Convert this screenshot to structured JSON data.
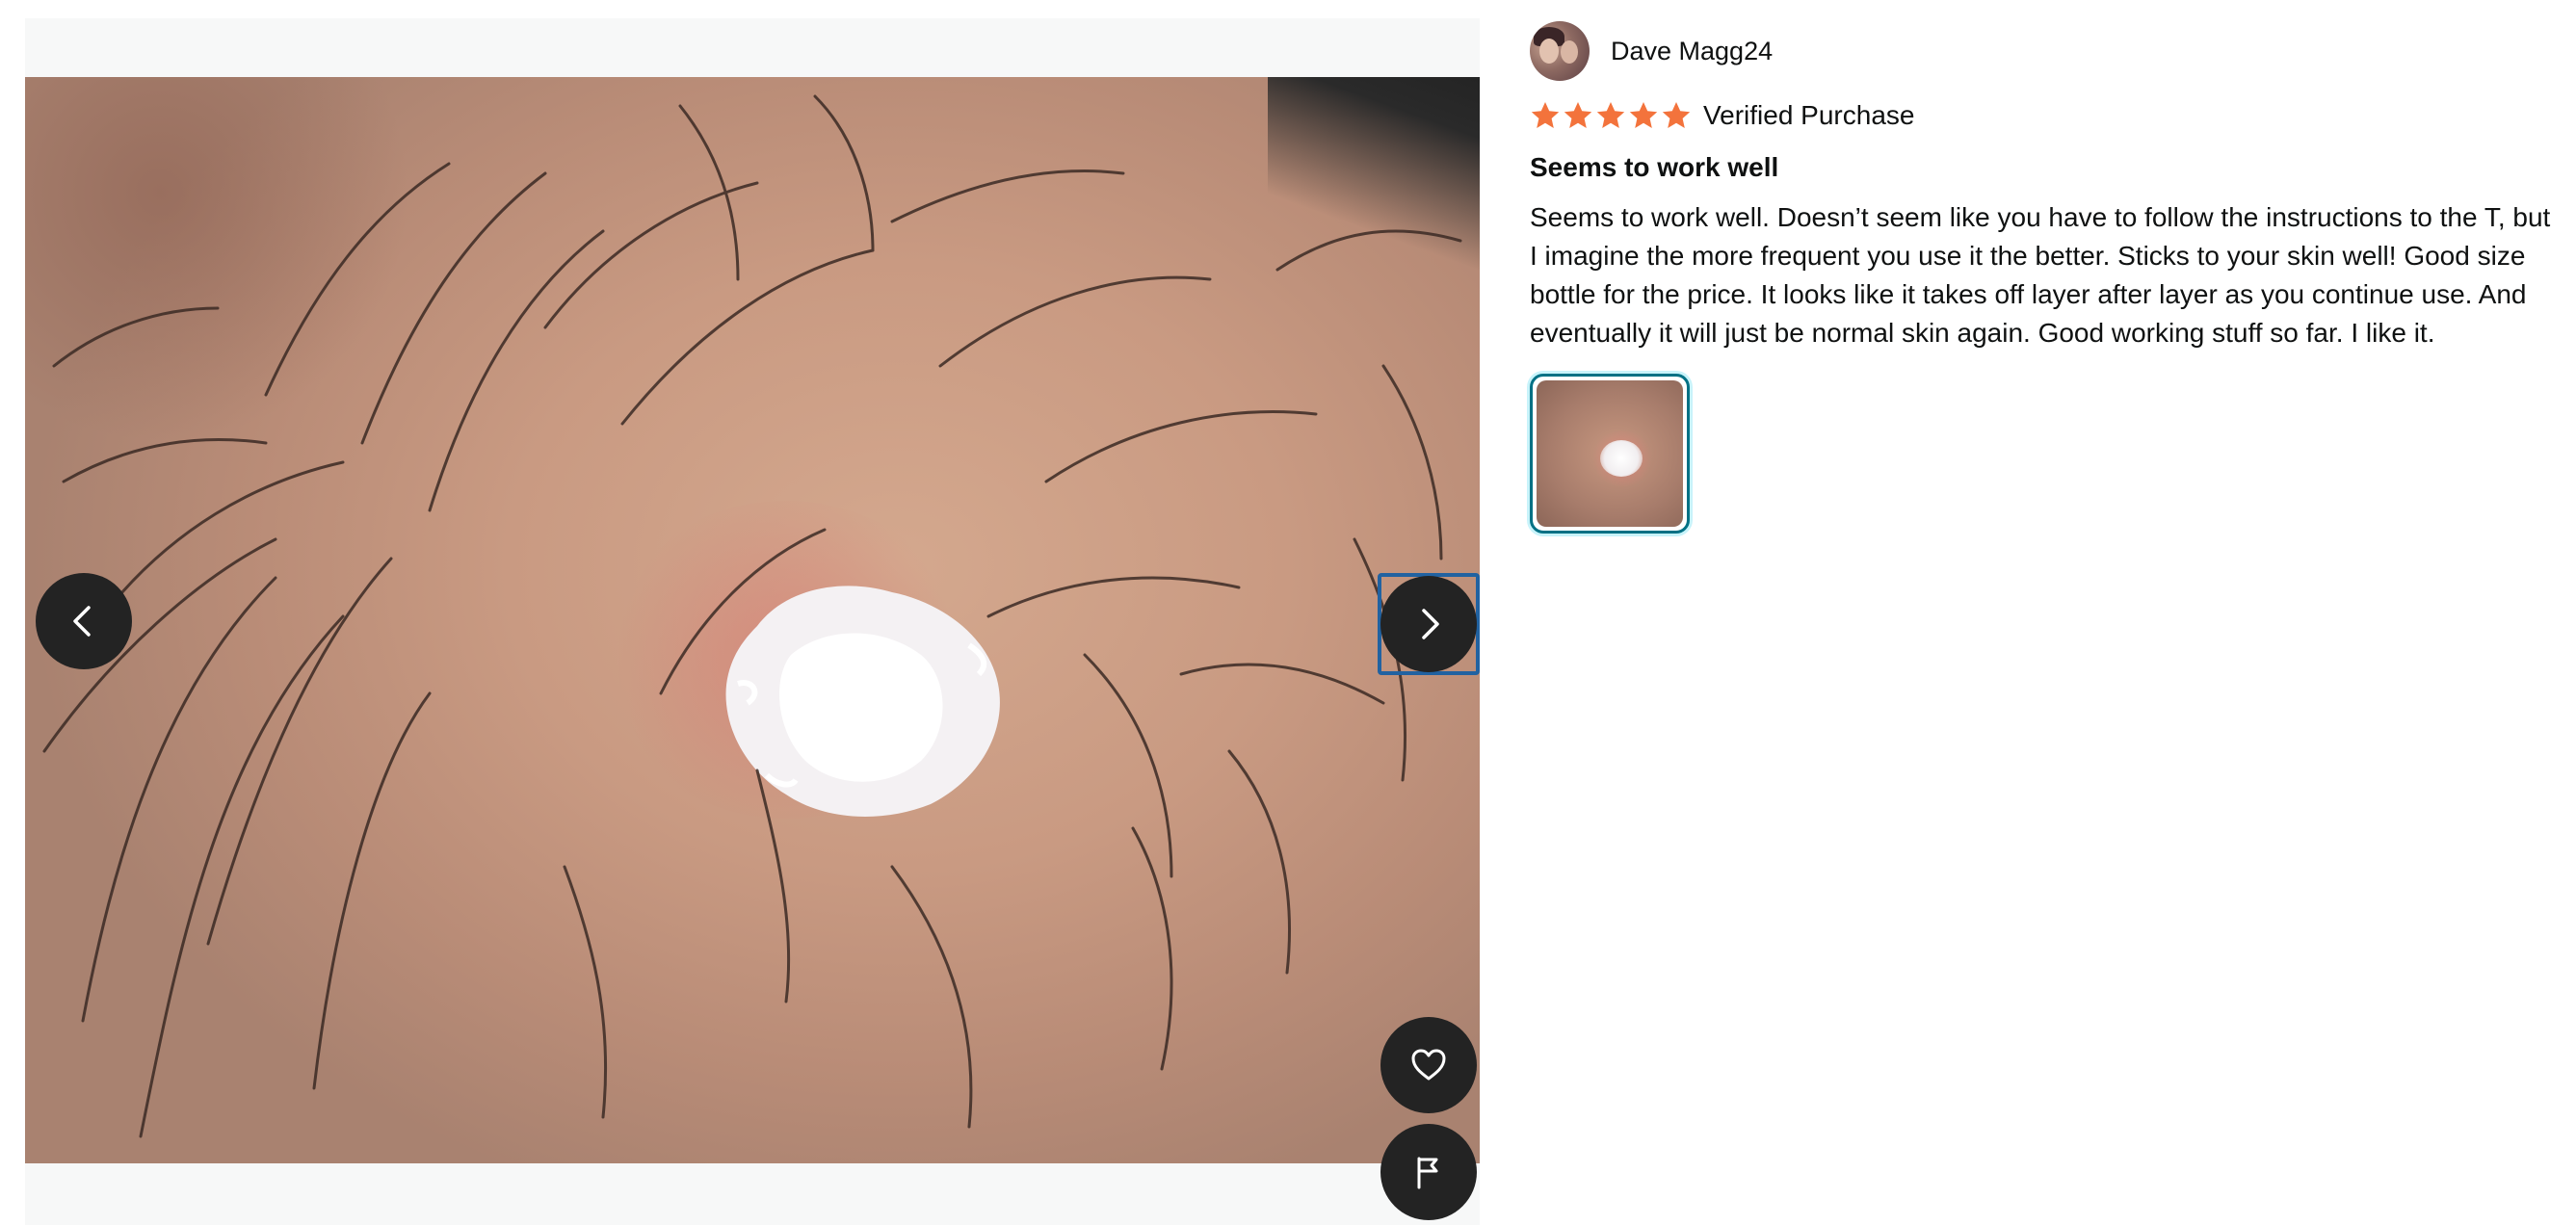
{
  "viewer": {
    "prev_icon": "chevron-left-icon",
    "next_icon": "chevron-right-icon",
    "like_icon": "heart-icon",
    "report_icon": "flag-icon"
  },
  "review": {
    "reviewer_name": "Dave Magg24",
    "rating": 5,
    "rating_max": 5,
    "star_color": "#f3733c",
    "verified_label": "Verified Purchase",
    "title": "Seems to work well",
    "body": "Seems to work well. Doesn’t seem like you have to follow the instructions to the T, but I imagine the more frequent you use it the better. Sticks to your skin well! Good size bottle for the price. It looks like it takes off layer after layer as you continue use. And eventually it will just be normal skin again. Good working stuff so far. I like it."
  },
  "colors": {
    "control_bg": "#232323",
    "focus_ring": "#2162a1",
    "thumb_border": "#007185"
  }
}
